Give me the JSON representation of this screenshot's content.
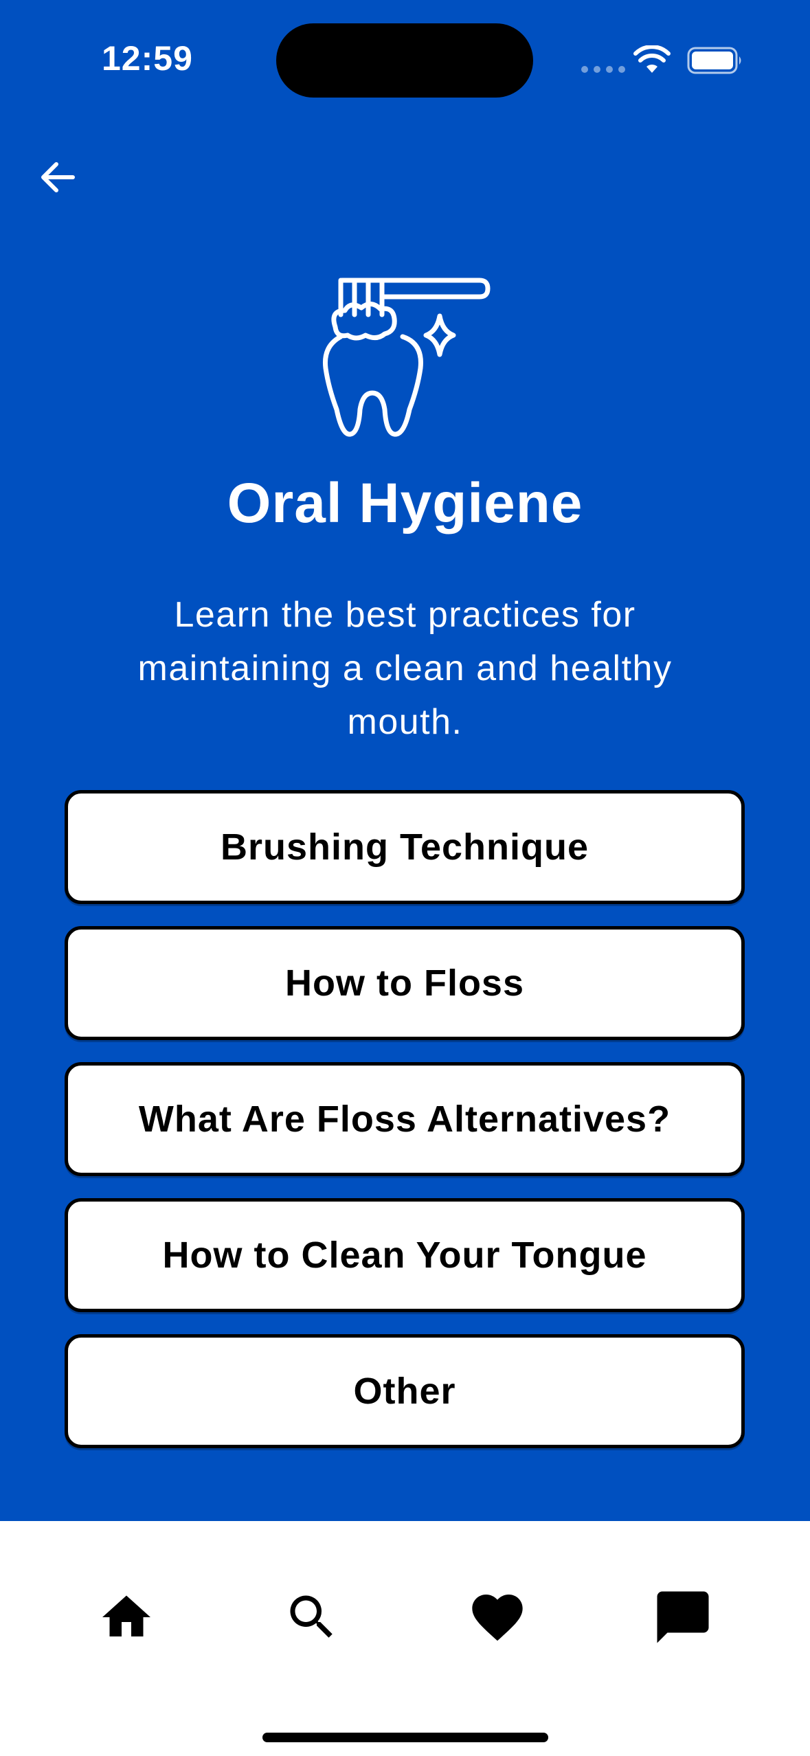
{
  "status_bar": {
    "time": "12:59"
  },
  "header": {
    "back_icon": "arrow-left-icon"
  },
  "hero": {
    "icon": "tooth-brushing-icon",
    "title": "Oral Hygiene",
    "subtitle": "Learn the best practices for maintaining a clean and healthy mouth."
  },
  "topics": [
    {
      "label": "Brushing Technique"
    },
    {
      "label": "How to Floss"
    },
    {
      "label": "What Are Floss Alternatives?"
    },
    {
      "label": "How to Clean Your Tongue"
    },
    {
      "label": "Other"
    }
  ],
  "tab_bar": {
    "items": [
      {
        "icon": "home-icon"
      },
      {
        "icon": "search-icon"
      },
      {
        "icon": "heart-icon"
      },
      {
        "icon": "chat-icon"
      }
    ]
  },
  "colors": {
    "background": "#0050C0",
    "button_bg": "#FFFFFF",
    "button_border": "#000000",
    "text_light": "#FFFFFF",
    "text_dark": "#000000"
  }
}
